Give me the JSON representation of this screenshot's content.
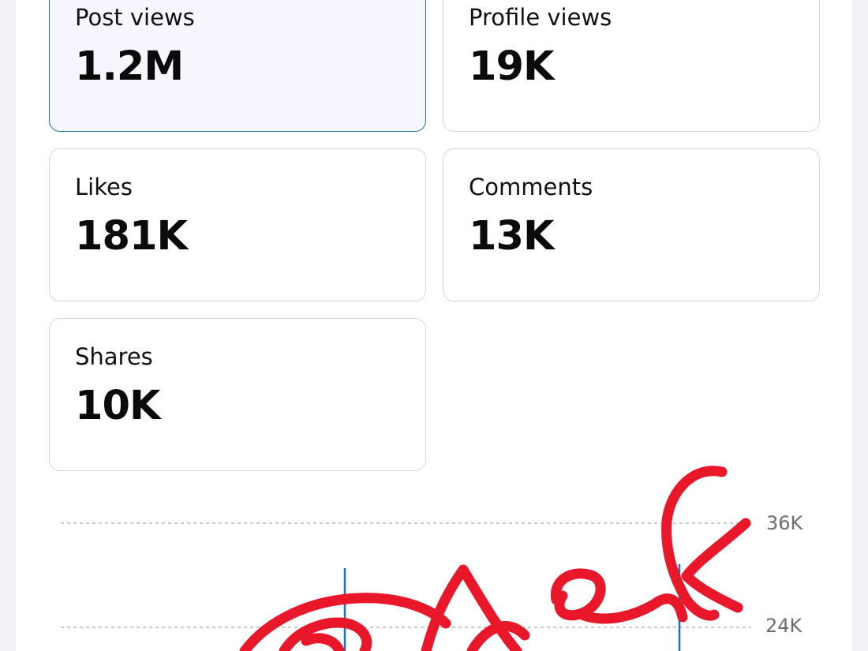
{
  "metrics": {
    "post_views": {
      "label": "Post views",
      "value": "1.2M"
    },
    "profile_views": {
      "label": "Profile views",
      "value": "19K"
    },
    "likes": {
      "label": "Likes",
      "value": "181K"
    },
    "comments": {
      "label": "Comments",
      "value": "13K"
    },
    "shares": {
      "label": "Shares",
      "value": "10K"
    }
  },
  "chart_data": {
    "type": "line",
    "y_ticks": [
      "36K",
      "24K"
    ],
    "series_color": "#1f6fbf",
    "annotation_color": "#e8182a"
  }
}
